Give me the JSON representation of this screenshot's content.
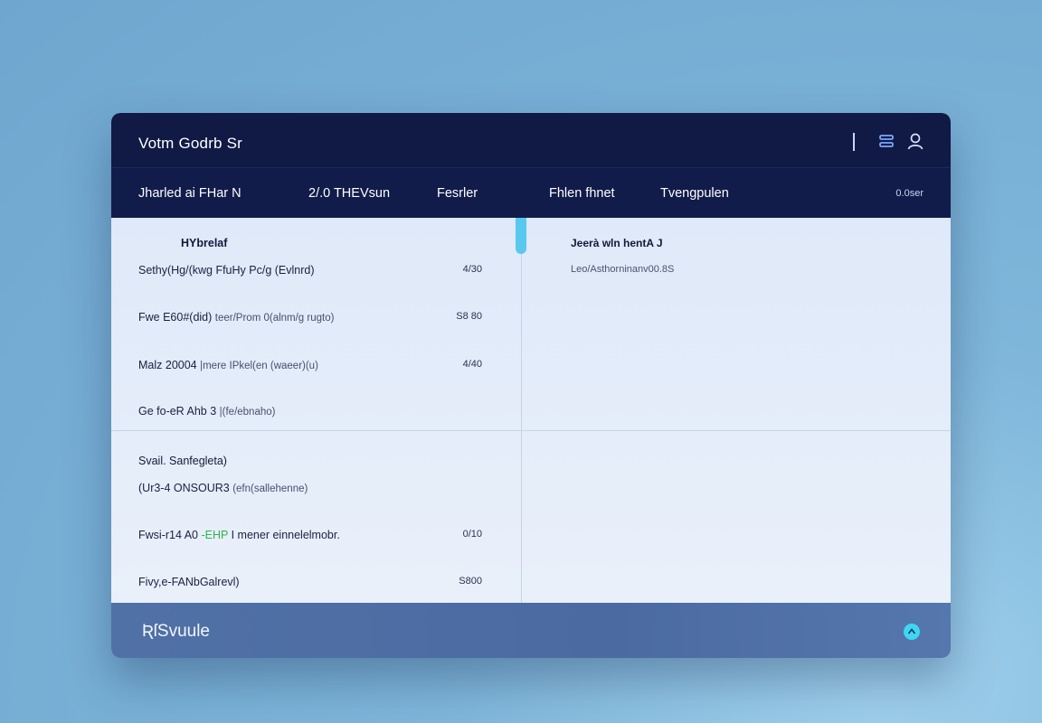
{
  "window": {
    "title": "Votm Godrb Sr"
  },
  "navbar": {
    "items": [
      {
        "label": "Jharled ai FHar N"
      },
      {
        "label": "2/.0 THEVsun"
      },
      {
        "label": "Fesrler"
      },
      {
        "label": "Fhlen fhnet"
      },
      {
        "label": "Tvengpulen"
      }
    ],
    "date": "0.0ser"
  },
  "left_panel": {
    "section1_title": "HYbrelaf",
    "rows1": [
      {
        "label": "Sethy(Hg/(kwg FfuHy Pc/g (Evlnrd)",
        "value": "4/30"
      },
      {
        "label": "Fwe E60#(did)",
        "muted": "teer/Prom 0(alnm/g rugto)",
        "value": "S8 80"
      },
      {
        "label": "Malz 20004",
        "muted": "|mere IPkel(en (waeer)(u)",
        "value": "4/40"
      },
      {
        "label": "Ge fo-eR Ahb 3",
        "muted": "|(fe/ebnaho)",
        "value": ""
      }
    ],
    "section2_title": "Svail. Sanfegleta)",
    "rows2": [
      {
        "label": "(Ur3-4 ONSOUR3",
        "muted": "(efn(sallehenne)",
        "value": ""
      },
      {
        "label": "Fwsi-r14 A0",
        "green": "-EHP",
        "label2": "I  mener einnelelmobr.",
        "value": "0/10"
      },
      {
        "label": "Fivy,e-FANbGalrevl)",
        "muted": "",
        "value": "S800"
      }
    ]
  },
  "right_panel": {
    "title": "Jeerà wln hentA J",
    "subtitle": "Leo/Asthorninanv00.8S"
  },
  "footer": {
    "label": "ƦſSvuule"
  },
  "colors": {
    "titlebar": "#101a45",
    "navbar": "#121c4a",
    "accent": "#58c8ee",
    "footer": "#4b6aa2"
  }
}
